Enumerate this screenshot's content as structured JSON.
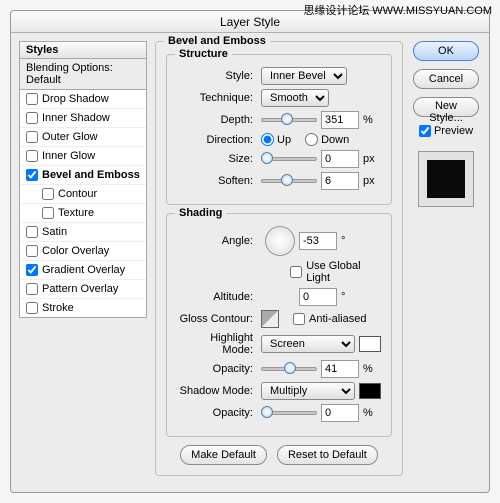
{
  "title": "Layer Style",
  "sidebar": {
    "header": "Styles",
    "blending": "Blending Options: Default",
    "items": [
      {
        "label": "Drop Shadow",
        "checked": false,
        "sub": false
      },
      {
        "label": "Inner Shadow",
        "checked": false,
        "sub": false
      },
      {
        "label": "Outer Glow",
        "checked": false,
        "sub": false
      },
      {
        "label": "Inner Glow",
        "checked": false,
        "sub": false
      },
      {
        "label": "Bevel and Emboss",
        "checked": true,
        "sub": false,
        "active": true
      },
      {
        "label": "Contour",
        "checked": false,
        "sub": true
      },
      {
        "label": "Texture",
        "checked": false,
        "sub": true
      },
      {
        "label": "Satin",
        "checked": false,
        "sub": false
      },
      {
        "label": "Color Overlay",
        "checked": false,
        "sub": false
      },
      {
        "label": "Gradient Overlay",
        "checked": true,
        "sub": false
      },
      {
        "label": "Pattern Overlay",
        "checked": false,
        "sub": false
      },
      {
        "label": "Stroke",
        "checked": false,
        "sub": false
      }
    ]
  },
  "panel_title": "Bevel and Emboss",
  "structure": {
    "legend": "Structure",
    "style_label": "Style:",
    "style_value": "Inner Bevel",
    "technique_label": "Technique:",
    "technique_value": "Smooth",
    "depth_label": "Depth:",
    "depth_value": "351",
    "depth_unit": "%",
    "direction_label": "Direction:",
    "up": "Up",
    "down": "Down",
    "dir_value": "up",
    "size_label": "Size:",
    "size_value": "0",
    "size_unit": "px",
    "soften_label": "Soften:",
    "soften_value": "6",
    "soften_unit": "px"
  },
  "shading": {
    "legend": "Shading",
    "angle_label": "Angle:",
    "angle_value": "-53",
    "angle_unit": "°",
    "global_label": "Use Global Light",
    "global_checked": false,
    "altitude_label": "Altitude:",
    "altitude_value": "0",
    "altitude_unit": "°",
    "gloss_label": "Gloss Contour:",
    "aa_label": "Anti-aliased",
    "aa_checked": false,
    "highlight_label": "Highlight Mode:",
    "highlight_value": "Screen",
    "h_opacity_label": "Opacity:",
    "h_opacity_value": "41",
    "pct": "%",
    "shadow_label": "Shadow Mode:",
    "shadow_value": "Multiply",
    "s_opacity_label": "Opacity:",
    "s_opacity_value": "0"
  },
  "buttons": {
    "make_default": "Make Default",
    "reset": "Reset to Default",
    "ok": "OK",
    "cancel": "Cancel",
    "new_style": "New Style...",
    "preview": "Preview",
    "preview_checked": true
  },
  "watermark": [
    "思缘设计论坛",
    "WWW.MISSYUAN.COM"
  ]
}
